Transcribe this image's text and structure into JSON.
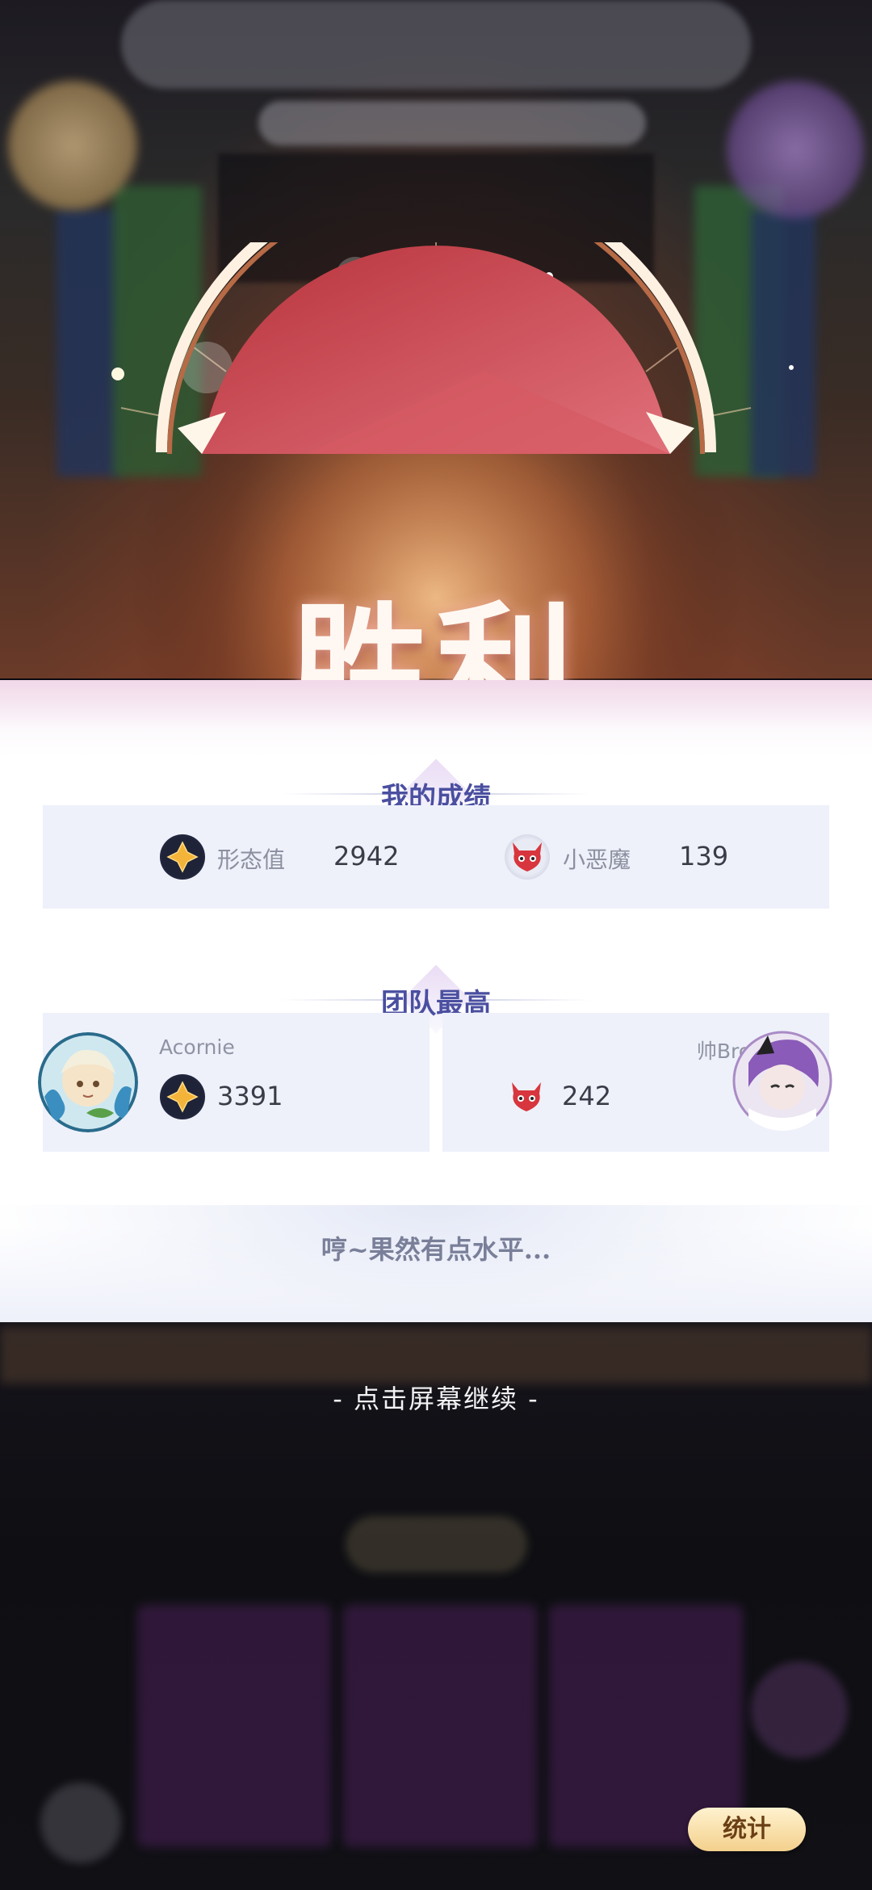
{
  "result": {
    "title": "胜利"
  },
  "my_score": {
    "section_title": "我的成绩",
    "stats": [
      {
        "icon": "star-icon",
        "label": "形态值",
        "value": "2942"
      },
      {
        "icon": "devil-icon",
        "label": "小恶魔",
        "value": "139"
      }
    ]
  },
  "team_best": {
    "section_title": "团队最高",
    "players": [
      {
        "name": "Acornie",
        "stat_icon": "star-icon",
        "value": "3391"
      },
      {
        "name": "帅Bro",
        "stat_icon": "devil-icon",
        "value": "242"
      }
    ]
  },
  "taunt": "哼~果然有点水平...",
  "continue_hint": "- 点击屏幕继续 -",
  "stats_button": {
    "label": "统计"
  },
  "colors": {
    "accent": "#4a4fa0",
    "panel_bg": "#eef1fa",
    "victory_red": "#c8454c",
    "button_gold": "#f3d08c"
  }
}
